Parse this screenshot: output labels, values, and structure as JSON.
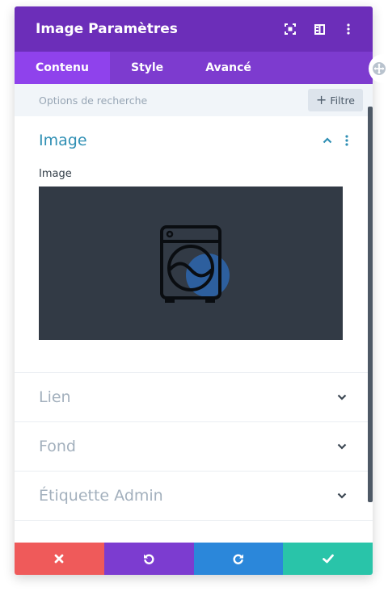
{
  "header": {
    "title": "Image Paramètres",
    "icons": [
      "expand-icon",
      "split-view-icon",
      "more-vertical-icon"
    ]
  },
  "tabs": [
    {
      "label": "Contenu",
      "active": true
    },
    {
      "label": "Style",
      "active": false
    },
    {
      "label": "Avancé",
      "active": false
    }
  ],
  "search": {
    "placeholder": "Options de recherche",
    "filter_label": "Filtre"
  },
  "sections": {
    "image": {
      "title": "Image",
      "expanded": true,
      "field_label": "Image",
      "preview_icon": "washing-machine-icon"
    },
    "toggles": [
      {
        "label": "Lien"
      },
      {
        "label": "Fond"
      },
      {
        "label": "Étiquette Admin"
      }
    ]
  },
  "footer": {
    "buttons": [
      "close-icon",
      "undo-icon",
      "redo-icon",
      "check-icon"
    ]
  },
  "colors": {
    "header": "#6c2eb9",
    "tabs": "#7d3bcf",
    "tab_active": "#8f42ec",
    "accent_title": "#2f8fb4",
    "cancel": "#ef5a5a",
    "undo": "#7c3cd0",
    "redo": "#2b87da",
    "save": "#29c4a9"
  }
}
